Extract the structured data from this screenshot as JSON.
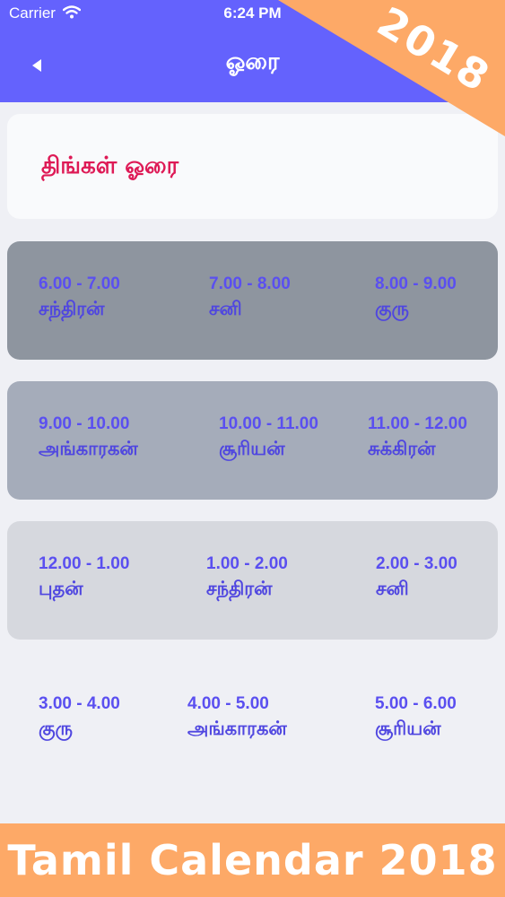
{
  "status_bar": {
    "carrier": "Carrier",
    "time": "6:24 PM"
  },
  "nav": {
    "title": "ஓரை",
    "back_icon": "chevron-left-icon"
  },
  "corner_badge": {
    "label": "2018",
    "color": "#fda967"
  },
  "header": {
    "title": "திங்கள் ஓரை"
  },
  "slot_rows": [
    {
      "background": "#8e959f",
      "slots": [
        {
          "time": "6.00 - 7.00",
          "planet": "சந்திரன்"
        },
        {
          "time": "7.00 - 8.00",
          "planet": "சனி"
        },
        {
          "time": "8.00 - 9.00",
          "planet": "குரு"
        }
      ]
    },
    {
      "background": "#a5acba",
      "slots": [
        {
          "time": "9.00 - 10.00",
          "planet": "அங்காரகன்"
        },
        {
          "time": "10.00 - 11.00",
          "planet": "சூரியன்"
        },
        {
          "time": "11.00 - 12.00",
          "planet": "சுக்கிரன்"
        }
      ]
    },
    {
      "background": "#d6d8de",
      "slots": [
        {
          "time": "12.00 - 1.00",
          "planet": "புதன்"
        },
        {
          "time": "1.00 - 2.00",
          "planet": "சந்திரன்"
        },
        {
          "time": "2.00 - 3.00",
          "planet": "சனி"
        }
      ]
    },
    {
      "background": "#eff0f5",
      "slots": [
        {
          "time": "3.00 - 4.00",
          "planet": "குரு"
        },
        {
          "time": "4.00 - 5.00",
          "planet": "அங்காரகன்"
        },
        {
          "time": "5.00 - 6.00",
          "planet": "சூரியன்"
        }
      ]
    }
  ],
  "footer": {
    "text": "Tamil Calendar 2018",
    "color": "#fda967"
  },
  "colors": {
    "nav": "#6462fd",
    "accent_red": "#de1a56",
    "slot_text": "#5a4ff0"
  }
}
